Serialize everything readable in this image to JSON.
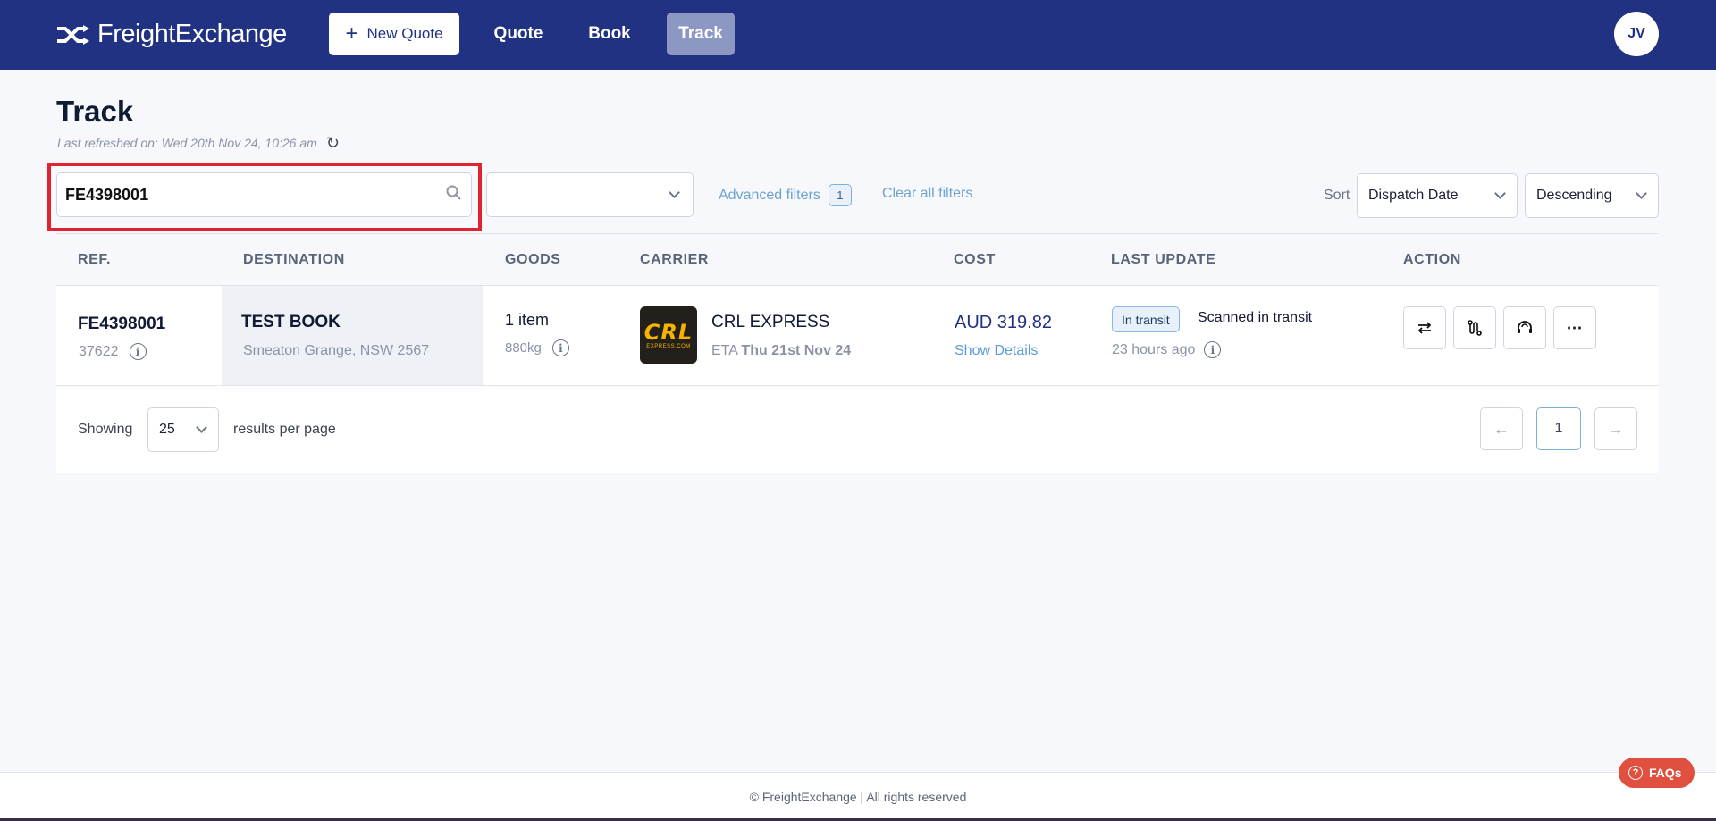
{
  "header": {
    "logo_text": "FreightExchange",
    "new_quote_label": "New Quote",
    "nav": {
      "quote": "Quote",
      "book": "Book",
      "track": "Track"
    },
    "avatar_initials": "JV",
    "brand_color": "#213282"
  },
  "page": {
    "title": "Track",
    "last_refreshed": "Last refreshed on: Wed 20th Nov 24, 10:26 am"
  },
  "filters": {
    "search_value": "FE4398001",
    "status_dropdown_value": "",
    "advanced_filters_label": "Advanced filters",
    "advanced_filters_count": "1",
    "clear_all_label": "Clear all filters",
    "sort_label": "Sort",
    "sort_field": "Dispatch Date",
    "sort_order": "Descending"
  },
  "table": {
    "columns": {
      "ref": "REF.",
      "destination": "DESTINATION",
      "goods": "GOODS",
      "carrier": "CARRIER",
      "cost": "COST",
      "last_update": "LAST UPDATE",
      "action": "ACTION"
    },
    "rows": [
      {
        "ref": "FE4398001",
        "ref_sub": "37622",
        "destination_name": "TEST BOOK",
        "destination_address": "Smeaton Grange, NSW 2567",
        "goods_count": "1 item",
        "goods_weight": "880kg",
        "carrier_logo_text": "CRL",
        "carrier_logo_sub": "EXPRESS.COM",
        "carrier_name": "CRL EXPRESS",
        "eta_label": "ETA",
        "eta_date": "Thu 21st Nov 24",
        "cost": "AUD 319.82",
        "show_details": "Show Details",
        "status_badge": "In transit",
        "status_text": "Scanned in transit",
        "status_time": "23 hours ago"
      }
    ]
  },
  "pagination": {
    "showing_label": "Showing",
    "per_page_value": "25",
    "results_per_page_label": "results per page",
    "current_page": "1"
  },
  "footer": {
    "copyright": "© FreightExchange | All rights reserved",
    "faq_label": "FAQs"
  }
}
